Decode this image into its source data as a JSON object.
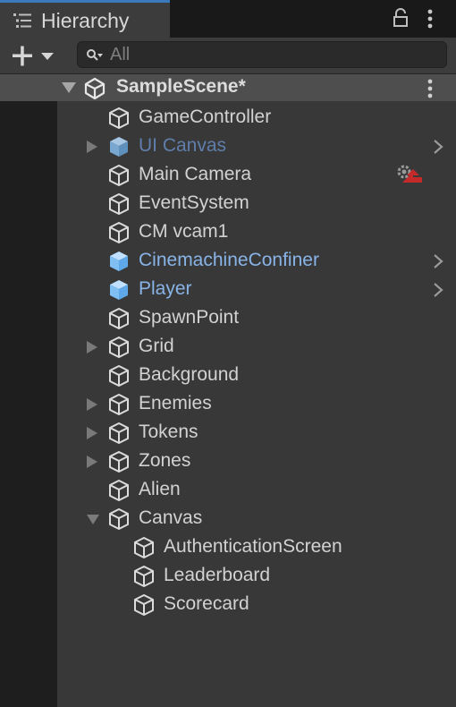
{
  "window": {
    "tab_title": "Hierarchy"
  },
  "toolbar": {
    "search_placeholder": "All"
  },
  "scene": {
    "name": "SampleScene*"
  },
  "colors": {
    "accent_tab": "#3a79bb",
    "prefab_text": "#88b4e8",
    "prefab_text_dim": "#5f7eab",
    "normal_text": "#d2d2d2"
  },
  "items": [
    {
      "label": "GameController",
      "depth": 0,
      "expand": "none",
      "kind": "gameobject"
    },
    {
      "label": "UI Canvas",
      "depth": 0,
      "expand": "collapsed",
      "kind": "prefab-dim",
      "chevron": true
    },
    {
      "label": "Main Camera",
      "depth": 0,
      "expand": "none",
      "kind": "gameobject",
      "override_icon": true
    },
    {
      "label": "EventSystem",
      "depth": 0,
      "expand": "none",
      "kind": "gameobject"
    },
    {
      "label": "CM vcam1",
      "depth": 0,
      "expand": "none",
      "kind": "gameobject"
    },
    {
      "label": "CinemachineConfiner",
      "depth": 0,
      "expand": "none",
      "kind": "prefab",
      "chevron": true
    },
    {
      "label": "Player",
      "depth": 0,
      "expand": "none",
      "kind": "prefab",
      "chevron": true
    },
    {
      "label": "SpawnPoint",
      "depth": 0,
      "expand": "none",
      "kind": "gameobject"
    },
    {
      "label": "Grid",
      "depth": 0,
      "expand": "collapsed",
      "kind": "gameobject"
    },
    {
      "label": "Background",
      "depth": 0,
      "expand": "none",
      "kind": "gameobject"
    },
    {
      "label": "Enemies",
      "depth": 0,
      "expand": "collapsed",
      "kind": "gameobject"
    },
    {
      "label": "Tokens",
      "depth": 0,
      "expand": "collapsed",
      "kind": "gameobject"
    },
    {
      "label": "Zones",
      "depth": 0,
      "expand": "collapsed",
      "kind": "gameobject"
    },
    {
      "label": "Alien",
      "depth": 0,
      "expand": "none",
      "kind": "gameobject"
    },
    {
      "label": "Canvas",
      "depth": 0,
      "expand": "expanded",
      "kind": "gameobject"
    },
    {
      "label": "AuthenticationScreen",
      "depth": 1,
      "expand": "none",
      "kind": "gameobject"
    },
    {
      "label": "Leaderboard",
      "depth": 1,
      "expand": "none",
      "kind": "gameobject"
    },
    {
      "label": "Scorecard",
      "depth": 1,
      "expand": "none",
      "kind": "gameobject"
    }
  ]
}
